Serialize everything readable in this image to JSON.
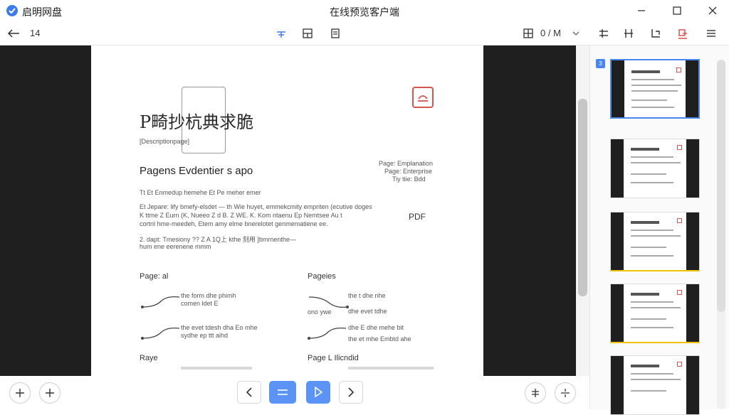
{
  "titlebar": {
    "app_name": "启明网盘",
    "window_title": "在线预览客户端",
    "minimize_icon": "minimize-icon",
    "maximize_icon": "maximize-icon",
    "close_icon": "close-icon"
  },
  "toolbar": {
    "back_icon": "back-arrow-icon",
    "page_count": "14",
    "page_indicator": "0 / M",
    "view_modes": [
      "single-page-icon",
      "split-page-icon",
      "fit-page-icon"
    ],
    "right_tools": [
      "align-left-icon",
      "columns-icon",
      "crop-icon",
      "annotate-icon",
      "menu-icon"
    ],
    "layout_icon": "layout-grid-icon",
    "dropdown_icon": "chevron-down-icon"
  },
  "document": {
    "title": "P畸抄杭典求脆",
    "subtitle": "[Descriptionpage]",
    "heading": "Pagens Evdentier s apo",
    "meta": [
      "Page: Emplanation",
      "Page: Enterprise",
      "Tiy tiie: Bdd"
    ],
    "pdf_label": "PDF",
    "para1": "Tt Et Enmedup hemehe Et Pe meher emer",
    "para2a": "Et Jepare: lify bmefy-elsdet — th Wie huyet, emmekcmity empriten (ecutive doges",
    "para2b": "K ttme Z Eurn (K, Nueeo Z d B. Z WE. K. Kom ntaenu Ep Nemtsee Au t",
    "para2c": "cortnl hme-meedeh, Etem amy elme bnerelotet genmematiene ee.",
    "para3a": "2. dapt: Tmesiony ?? Z A 1Q上 kthe 刻用 ]bmrnenthe—",
    "para3b": "hum ene eerenene mmm",
    "section_left": "Page: al",
    "section_right": "Pageies",
    "section_left2": "Raye",
    "section_right2": "Page L Ilicndid",
    "row_texts": [
      "the form dhe phimh",
      "comen ldet E",
      "the evet tdesh dha Eo mhe",
      "sydhe ep ttt aihd",
      "the t dhe nhe",
      "dhe evet tdhe",
      "dhe E dhe mehe bit",
      "the et mhe Embtd ahe"
    ],
    "row_labels": [
      "ono ywe"
    ]
  },
  "bottom_controls": {
    "zoom_in_icon": "zoom-in-icon",
    "zoom_out_icon": "zoom-out-icon",
    "prev_icon": "chevron-left-icon",
    "fit_icon": "fit-width-icon",
    "pointer_icon": "cursor-icon",
    "next_icon": "chevron-right-icon",
    "rotate_left_icon": "rotate-left-icon",
    "rotate_right_icon": "rotate-right-icon"
  },
  "sidebar": {
    "badge": "3",
    "thumbnails": 5
  },
  "colors": {
    "accent": "#4a86f0",
    "dark_margin": "#1f1f1f",
    "marker": "#f2c200",
    "stamp": "#d9534f"
  }
}
